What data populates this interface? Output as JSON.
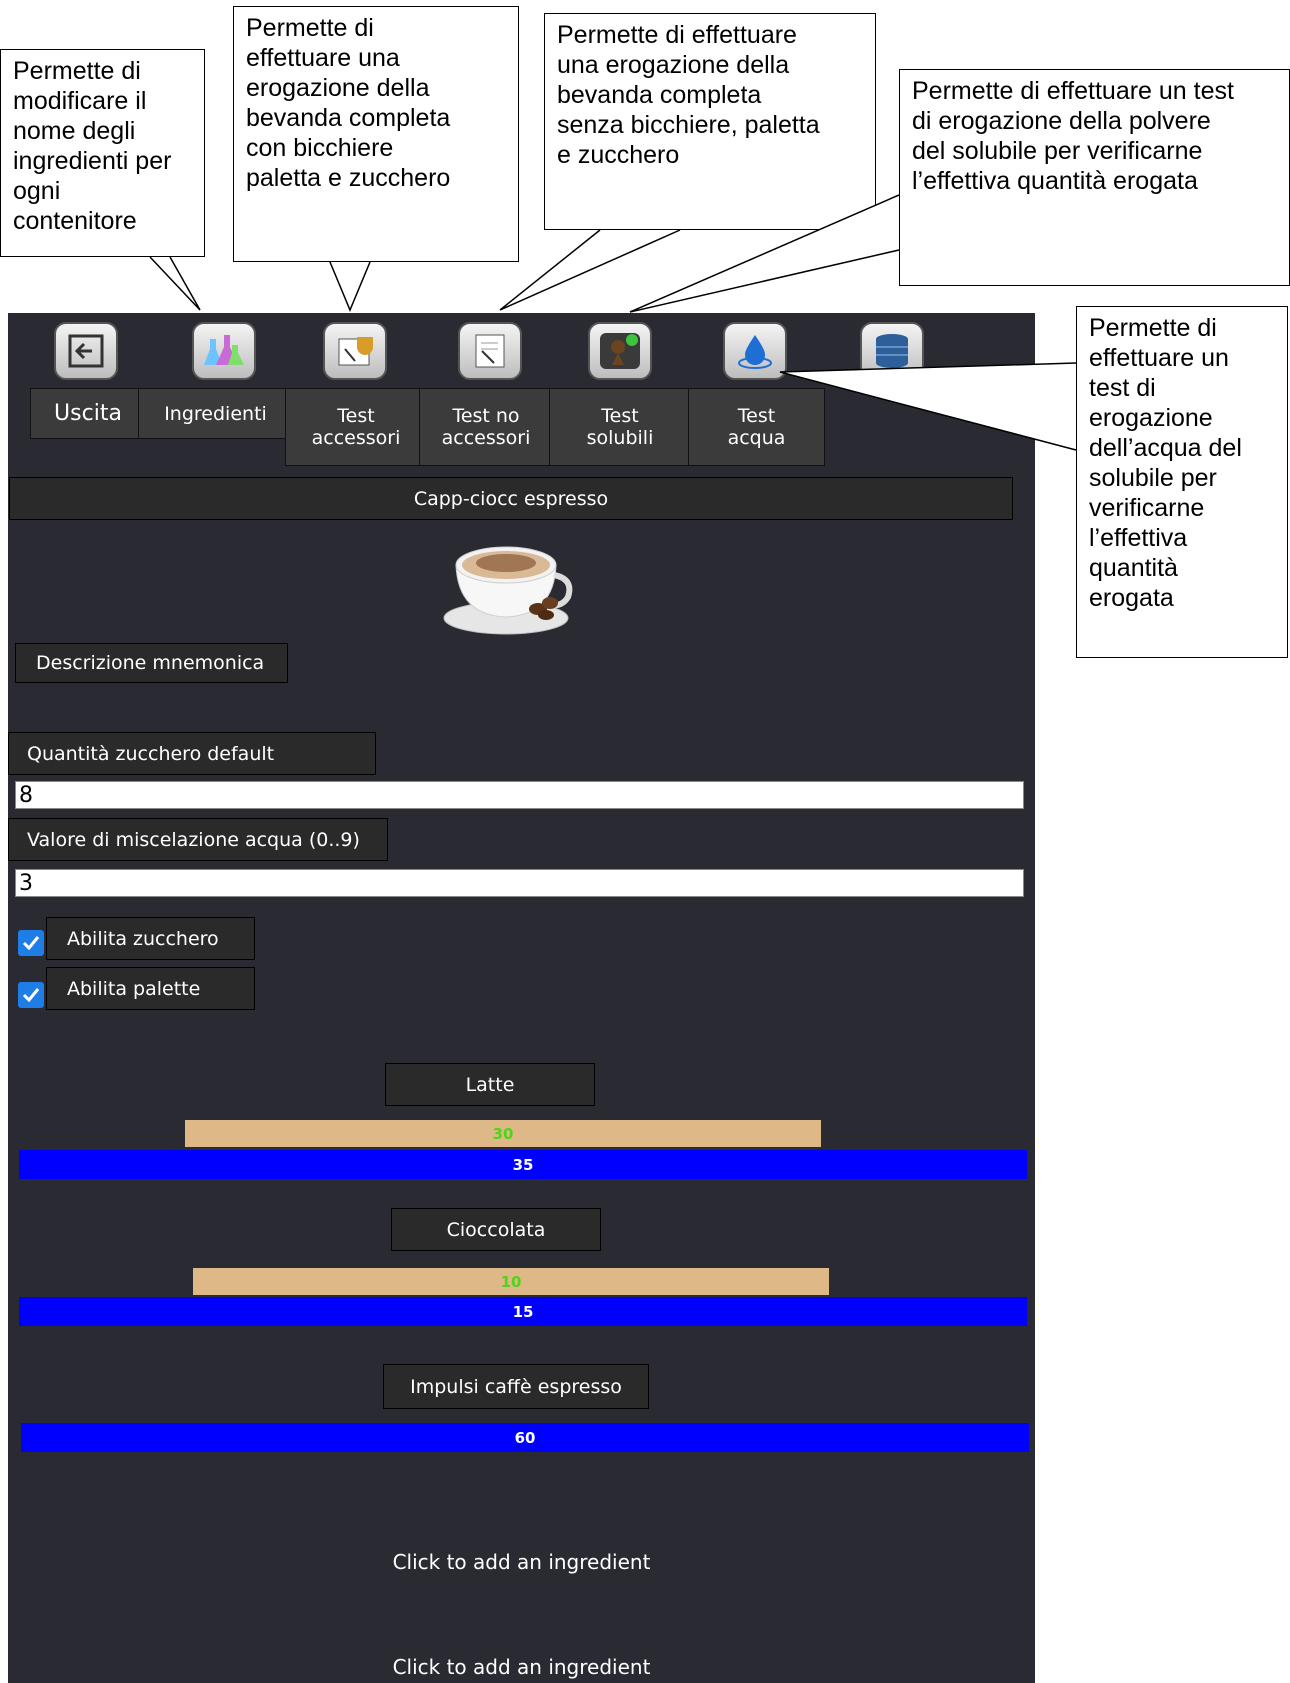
{
  "callouts": [
    "Permette di\nmodificare il\nnome degli\ningredienti per\nogni\ncontenitore",
    "Permette di\neffettuare una\nerogazione della\nbevanda completa\ncon bicchiere\npaletta e zucchero",
    "Permette di effettuare\nuna erogazione della\nbevanda completa\nsenza bicchiere, paletta\ne zucchero",
    "Permette di effettuare un test\ndi erogazione della polvere\ndel solubile per verificarne\nl’effettiva quantità erogata",
    "Permette di\neffettuare un\ntest di\nerogazione\ndell’acqua del\nsolubile per\nverificarne\nl’effettiva\nquantità\nerogata"
  ],
  "toolbar": {
    "icons": [
      "exit-icon",
      "flasks-icon",
      "coffee-test-icon",
      "checklist-icon",
      "coffee-dose-icon",
      "water-drop-icon",
      "database-icon"
    ],
    "tabs": [
      "Uscita",
      "Ingredienti",
      "Test\naccessori",
      "Test no\naccessori",
      "Test\nsolubili",
      "Test\nacqua"
    ]
  },
  "drink": {
    "name": "Capp-ciocc espresso",
    "image": "cappuccino-cup-icon"
  },
  "fields": {
    "mnemonic_label": "Descrizione mnemonica",
    "sugar_label": "Quantità zucchero default",
    "sugar_value": "8",
    "mix_label": "Valore di miscelazione acqua (0..9)",
    "mix_value": "3",
    "enable_sugar": {
      "label": "Abilita zucchero",
      "checked": true
    },
    "enable_stirrer": {
      "label": "Abilita palette",
      "checked": true
    }
  },
  "ingredients": [
    {
      "name": "Latte",
      "powder": "30",
      "water": "35"
    },
    {
      "name": "Cioccolata",
      "powder": "10",
      "water": "15"
    },
    {
      "name": "Impulsi caffè espresso",
      "pulses": "60"
    }
  ],
  "add_ingredient": [
    "Click to add an ingredient",
    "Click to add an ingredient"
  ],
  "colors": {
    "background": "#2a2a33",
    "powder_bar": "#deb887",
    "water_bar": "#0000ff",
    "powder_text": "#4cd61a",
    "checkbox": "#1f7de6"
  }
}
